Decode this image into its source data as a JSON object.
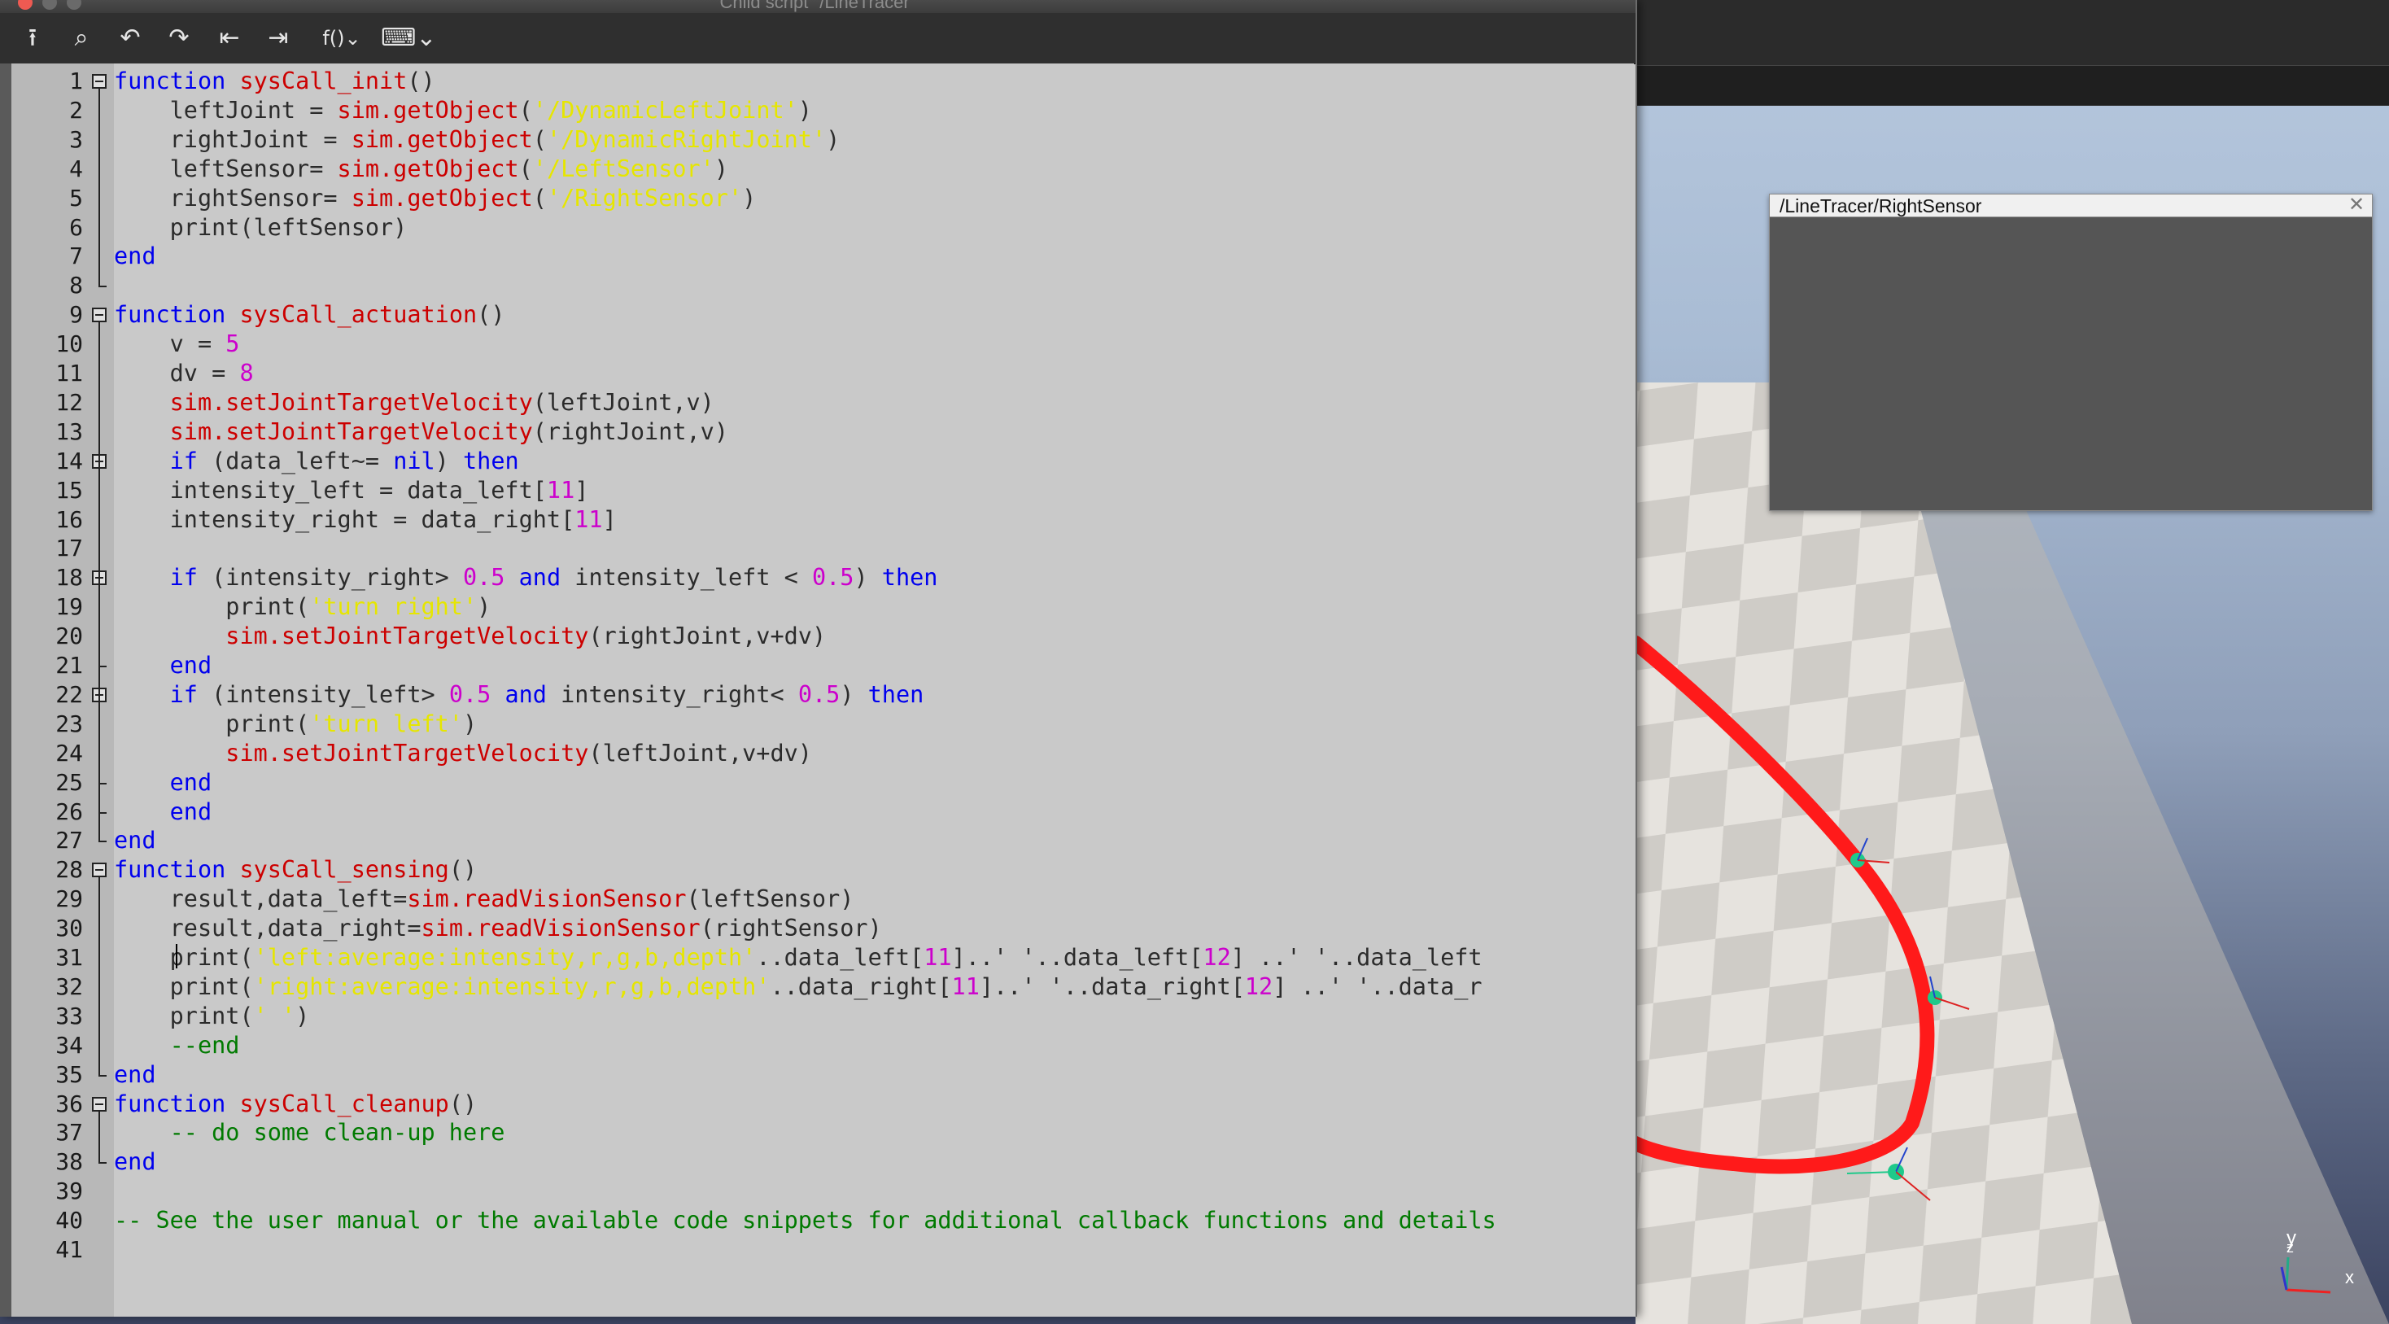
{
  "window": {
    "title": "Child script \"/LineTracer\"",
    "traffic_colors": [
      "#ee5a52",
      "#6a6a6a",
      "#6a6a6a"
    ]
  },
  "toolbar": [
    {
      "icon": "export-icon",
      "glyph": "⭱"
    },
    {
      "icon": "search-icon",
      "glyph": "⌕"
    },
    {
      "icon": "undo-icon",
      "glyph": "↶"
    },
    {
      "icon": "redo-icon",
      "glyph": "↷"
    },
    {
      "icon": "indent-icon",
      "glyph": "⇤"
    },
    {
      "icon": "outdent-icon",
      "glyph": "⇥"
    },
    {
      "icon": "functions-menu-icon",
      "glyph": "f()⌄"
    },
    {
      "icon": "snippets-menu-icon",
      "glyph": "⌨⌄"
    }
  ],
  "sensor_window": {
    "title": "/LineTracer/RightSensor",
    "close_glyph": "✕"
  },
  "axis_widget": {
    "y": "y",
    "z": "z",
    "x": "x"
  },
  "editor": {
    "colors": {
      "keyword": "#0000ee",
      "function": "#cc0000",
      "string": "#e6e600",
      "number": "#cc00cc",
      "comment": "#007a00"
    },
    "lines": [
      [
        [
          "kw",
          "function"
        ],
        [
          "id",
          " "
        ],
        [
          "fn",
          "sysCall_init"
        ],
        [
          "id",
          "()"
        ]
      ],
      [
        [
          "id",
          "    leftJoint = "
        ],
        [
          "fn",
          "sim.getObject"
        ],
        [
          "id",
          "("
        ],
        [
          "str",
          "'/DynamicLeftJoint'"
        ],
        [
          "id",
          ")"
        ]
      ],
      [
        [
          "id",
          "    rightJoint = "
        ],
        [
          "fn",
          "sim.getObject"
        ],
        [
          "id",
          "("
        ],
        [
          "str",
          "'/DynamicRightJoint'"
        ],
        [
          "id",
          ")"
        ]
      ],
      [
        [
          "id",
          "    leftSensor= "
        ],
        [
          "fn",
          "sim.getObject"
        ],
        [
          "id",
          "("
        ],
        [
          "str",
          "'/LeftSensor'"
        ],
        [
          "id",
          ")"
        ]
      ],
      [
        [
          "id",
          "    rightSensor= "
        ],
        [
          "fn",
          "sim.getObject"
        ],
        [
          "id",
          "("
        ],
        [
          "str",
          "'/RightSensor'"
        ],
        [
          "id",
          ")"
        ]
      ],
      [
        [
          "id",
          "    print(leftSensor)"
        ]
      ],
      [
        [
          "kw",
          "end"
        ]
      ],
      [],
      [
        [
          "kw",
          "function"
        ],
        [
          "id",
          " "
        ],
        [
          "fn",
          "sysCall_actuation"
        ],
        [
          "id",
          "()"
        ]
      ],
      [
        [
          "id",
          "    v = "
        ],
        [
          "num",
          "5"
        ]
      ],
      [
        [
          "id",
          "    dv = "
        ],
        [
          "num",
          "8"
        ]
      ],
      [
        [
          "id",
          "    "
        ],
        [
          "fn",
          "sim.setJointTargetVelocity"
        ],
        [
          "id",
          "(leftJoint,v)"
        ]
      ],
      [
        [
          "id",
          "    "
        ],
        [
          "fn",
          "sim.setJointTargetVelocity"
        ],
        [
          "id",
          "(rightJoint,v)"
        ]
      ],
      [
        [
          "id",
          "    "
        ],
        [
          "kw",
          "if"
        ],
        [
          "id",
          " (data_left~= "
        ],
        [
          "kw",
          "nil"
        ],
        [
          "id",
          ") "
        ],
        [
          "kw",
          "then"
        ]
      ],
      [
        [
          "id",
          "    intensity_left = data_left["
        ],
        [
          "num",
          "11"
        ],
        [
          "id",
          "]"
        ]
      ],
      [
        [
          "id",
          "    intensity_right = data_right["
        ],
        [
          "num",
          "11"
        ],
        [
          "id",
          "]"
        ]
      ],
      [],
      [
        [
          "id",
          "    "
        ],
        [
          "kw",
          "if"
        ],
        [
          "id",
          " (intensity_right> "
        ],
        [
          "num",
          "0.5"
        ],
        [
          "id",
          " "
        ],
        [
          "kw",
          "and"
        ],
        [
          "id",
          " intensity_left < "
        ],
        [
          "num",
          "0.5"
        ],
        [
          "id",
          ") "
        ],
        [
          "kw",
          "then"
        ]
      ],
      [
        [
          "id",
          "        print("
        ],
        [
          "str",
          "'turn right'"
        ],
        [
          "id",
          ")"
        ]
      ],
      [
        [
          "id",
          "        "
        ],
        [
          "fn",
          "sim.setJointTargetVelocity"
        ],
        [
          "id",
          "(rightJoint,v+dv)"
        ]
      ],
      [
        [
          "id",
          "    "
        ],
        [
          "kw",
          "end"
        ]
      ],
      [
        [
          "id",
          "    "
        ],
        [
          "kw",
          "if"
        ],
        [
          "id",
          " (intensity_left> "
        ],
        [
          "num",
          "0.5"
        ],
        [
          "id",
          " "
        ],
        [
          "kw",
          "and"
        ],
        [
          "id",
          " intensity_right< "
        ],
        [
          "num",
          "0.5"
        ],
        [
          "id",
          ") "
        ],
        [
          "kw",
          "then"
        ]
      ],
      [
        [
          "id",
          "        print("
        ],
        [
          "str",
          "'turn left'"
        ],
        [
          "id",
          ")"
        ]
      ],
      [
        [
          "id",
          "        "
        ],
        [
          "fn",
          "sim.setJointTargetVelocity"
        ],
        [
          "id",
          "(leftJoint,v+dv)"
        ]
      ],
      [
        [
          "id",
          "    "
        ],
        [
          "kw",
          "end"
        ]
      ],
      [
        [
          "id",
          "    "
        ],
        [
          "kw",
          "end"
        ]
      ],
      [
        [
          "kw",
          "end"
        ]
      ],
      [
        [
          "kw",
          "function"
        ],
        [
          "id",
          " "
        ],
        [
          "fn",
          "sysCall_sensing"
        ],
        [
          "id",
          "()"
        ]
      ],
      [
        [
          "id",
          "    result,data_left="
        ],
        [
          "fn",
          "sim.readVisionSensor"
        ],
        [
          "id",
          "(leftSensor)"
        ]
      ],
      [
        [
          "id",
          "    result,data_right="
        ],
        [
          "fn",
          "sim.readVisionSensor"
        ],
        [
          "id",
          "(rightSensor)"
        ]
      ],
      [
        [
          "id",
          "    print("
        ],
        [
          "str",
          "'left:average:intensity,r,g,b,depth'"
        ],
        [
          "id",
          "..data_left["
        ],
        [
          "num",
          "11"
        ],
        [
          "id",
          "]..' '..data_left["
        ],
        [
          "num",
          "12"
        ],
        [
          "id",
          "] ..' '..data_left"
        ]
      ],
      [
        [
          "id",
          "    print("
        ],
        [
          "str",
          "'right:average:intensity,r,g,b,depth'"
        ],
        [
          "id",
          "..data_right["
        ],
        [
          "num",
          "11"
        ],
        [
          "id",
          "]..' '..data_right["
        ],
        [
          "num",
          "12"
        ],
        [
          "id",
          "] ..' '..data_r"
        ]
      ],
      [
        [
          "id",
          "    print("
        ],
        [
          "str",
          "' '"
        ],
        [
          "id",
          ")"
        ]
      ],
      [
        [
          "cm",
          "    --end"
        ]
      ],
      [
        [
          "kw",
          "end"
        ]
      ],
      [
        [
          "kw",
          "function"
        ],
        [
          "id",
          " "
        ],
        [
          "fn",
          "sysCall_cleanup"
        ],
        [
          "id",
          "()"
        ]
      ],
      [
        [
          "cm",
          "    -- do some clean-up here"
        ]
      ],
      [
        [
          "kw",
          "end"
        ]
      ],
      [],
      [
        [
          "cm",
          "-- See the user manual or the available code snippets for additional callback functions and details"
        ]
      ],
      []
    ]
  }
}
